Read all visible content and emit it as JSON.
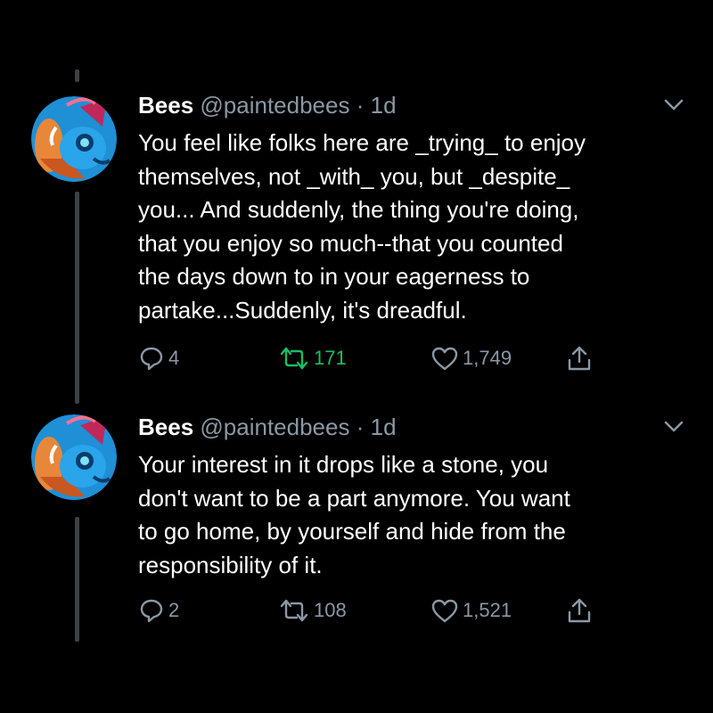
{
  "colors": {
    "background": "#000000",
    "text": "#ffffff",
    "muted": "#8b98a5",
    "retweet_active": "#17bf63",
    "thread_line": "#3d4145"
  },
  "tweets": [
    {
      "name": "Bees",
      "handle": "@paintedbees",
      "separator": "·",
      "time": "1d",
      "text": "You feel like folks here are _trying_ to enjoy\nthemselves, not _with_ you, but _despite_\nyou... And suddenly, the thing you're doing,\nthat you enjoy so much--that you counted\nthe days down to in your eagerness to\npartake...Suddenly, it's dreadful.",
      "replies": "4",
      "retweets": "171",
      "likes": "1,749",
      "retweeted": true,
      "icons": [
        "reply-icon",
        "retweet-icon",
        "like-icon",
        "share-icon",
        "chevron-down-icon"
      ]
    },
    {
      "name": "Bees",
      "handle": "@paintedbees",
      "separator": "·",
      "time": "1d",
      "text": "Your interest in it drops like a stone, you\ndon't want to be a part anymore. You want\nto go home, by yourself and hide from the\nresponsibility of it.",
      "replies": "2",
      "retweets": "108",
      "likes": "1,521",
      "retweeted": false,
      "icons": [
        "reply-icon",
        "retweet-icon",
        "like-icon",
        "share-icon",
        "chevron-down-icon"
      ]
    }
  ]
}
